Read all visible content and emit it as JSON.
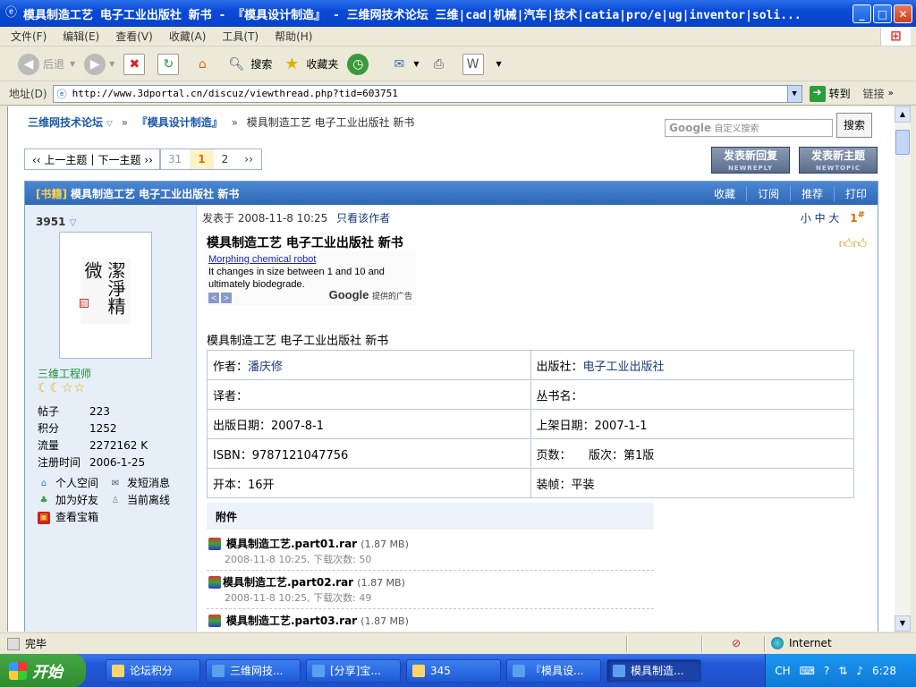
{
  "window": {
    "title": "模具制造工艺 电子工业出版社 新书 - 『模具设计制造』 - 三维网技术论坛 三维|cad|机械|汽车|技术|catia|pro/e|ug|inventor|soli...",
    "min": "_",
    "max": "□",
    "close": "✕"
  },
  "menu": [
    "文件(F)",
    "编辑(E)",
    "查看(V)",
    "收藏(A)",
    "工具(T)",
    "帮助(H)"
  ],
  "toolbar": {
    "back": "后退",
    "search": "搜索",
    "favorites": "收藏夹"
  },
  "address": {
    "label": "地址(D)",
    "url": "http://www.3dportal.cn/discuz/viewthread.php?tid=603751",
    "go": "转到",
    "links": "链接"
  },
  "breadcrumb": {
    "forum": "三维网技术论坛",
    "section": "『模具设计制造』",
    "current": "模具制造工艺 电子工业出版社 新书"
  },
  "search": {
    "placeholder": "自定义搜索",
    "google": "Google",
    "button": "搜索"
  },
  "nav": {
    "prev": "‹‹ 上一主题",
    "next": "下一主题 ››",
    "pages": [
      "31",
      "1",
      "2",
      "››"
    ],
    "current_page": "1"
  },
  "actions": {
    "reply": "发表新回复",
    "reply_en": "NEWREPLY",
    "topic": "发表新主题",
    "topic_en": "NEWTOPIC"
  },
  "thread": {
    "tag": "[书籍]",
    "title": "模具制造工艺 电子工业出版社 新书",
    "ops": [
      "收藏",
      "订阅",
      "推荐",
      "打印"
    ]
  },
  "user": {
    "name": "3951",
    "rank": "三维工程师",
    "avatar_text": "潔淨精微",
    "stats": [
      {
        "k": "帖子",
        "v": "223"
      },
      {
        "k": "积分",
        "v": "1252"
      },
      {
        "k": "流量",
        "v": "2272162 K"
      },
      {
        "k": "注册时间",
        "v": "2006-1-25"
      }
    ],
    "links": [
      "个人空间",
      "发短消息",
      "加为好友",
      "当前离线",
      "查看宝箱"
    ]
  },
  "post": {
    "meta": "发表于 2008-11-8 10:25",
    "author_only": "只看该作者",
    "fontsize": "小 中 大",
    "floor": "1",
    "title": "模具制造工艺 电子工业出版社 新书",
    "ad_link": "Morphing chemical robot",
    "ad_text": "It changes in size between 1 and 10 and ultimately biodegrade.",
    "ad_brand": "Google",
    "ad_suffix": "提供的广告",
    "subtitle": "模具制造工艺 电子工业出版社 新书",
    "book": [
      [
        {
          "k": "作者：",
          "v": "潘庆修"
        },
        {
          "k": "出版社：",
          "v": "电子工业出版社"
        }
      ],
      [
        {
          "k": "译者：",
          "v": ""
        },
        {
          "k": "丛书名：",
          "v": ""
        }
      ],
      [
        {
          "k": "出版日期：",
          "v": "2007-8-1"
        },
        {
          "k": "上架日期：",
          "v": "2007-1-1"
        }
      ],
      [
        {
          "k": "ISBN：",
          "v": "9787121047756"
        },
        {
          "k": "页数：",
          "v": "　　版次：第1版"
        }
      ],
      [
        {
          "k": "开本：",
          "v": "16开"
        },
        {
          "k": "装帧：",
          "v": "平装"
        }
      ]
    ],
    "attach_label": "附件",
    "files": [
      {
        "name": "模具制造工艺.part01.rar",
        "size": "(1.87 MB)",
        "meta": "2008-11-8 10:25, 下载次数: 50"
      },
      {
        "name": "模具制造工艺.part02.rar",
        "size": "(1.87 MB)",
        "meta": "2008-11-8 10:25, 下载次数: 49"
      },
      {
        "name": "模具制造工艺.part03.rar",
        "size": "(1.87 MB)",
        "meta": ""
      }
    ]
  },
  "status": {
    "text": "完毕",
    "zone": "Internet"
  },
  "taskbar": {
    "start": "开始",
    "tasks": [
      "论坛积分",
      "三维网技...",
      "[分享]宝...",
      "345",
      "『模具设...",
      "模具制造..."
    ],
    "lang": "CH",
    "time": "6:28"
  }
}
